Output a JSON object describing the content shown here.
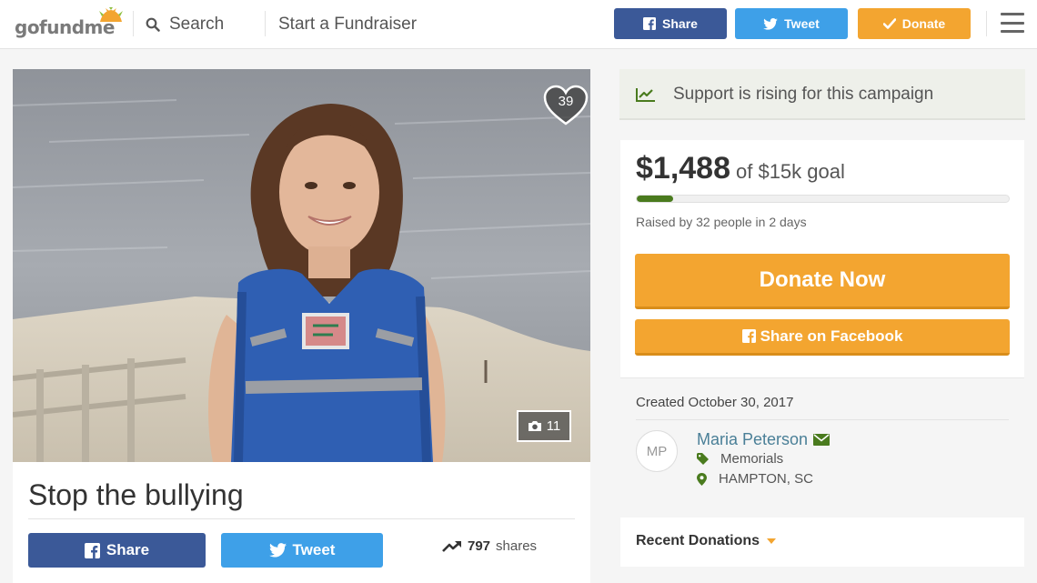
{
  "header": {
    "logo_text": "gofundme",
    "search_label": "Search",
    "start_label": "Start a Fundraiser",
    "share_label": "Share",
    "tweet_label": "Tweet",
    "donate_label": "Donate"
  },
  "photo": {
    "heart_count": "39",
    "photo_count": "11"
  },
  "campaign": {
    "title": "Stop the bullying",
    "share_label": "Share",
    "tweet_label": "Tweet",
    "shares_count": "797",
    "shares_label": "shares"
  },
  "trend": {
    "text": "Support is rising for this campaign"
  },
  "stats": {
    "amount": "$1,488",
    "goal": "of $15k goal",
    "progress_fraction": 0.099,
    "raised_by": "Raised by 32 people in 2 days",
    "donate_now_label": "Donate Now",
    "share_fb_label": "Share on Facebook"
  },
  "organizer": {
    "created": "Created October 30, 2017",
    "initials": "MP",
    "name": "Maria Peterson",
    "category": "Memorials",
    "location": "HAMPTON, SC"
  },
  "recent": {
    "label": "Recent Donations"
  },
  "colors": {
    "facebook": "#3b5998",
    "twitter": "#3ea0e8",
    "donate": "#f3a530",
    "progress": "#4a7b1e",
    "link": "#4a7f97"
  },
  "icons": [
    "search-icon",
    "facebook-icon",
    "twitter-icon",
    "check-icon",
    "menu-icon",
    "heart-icon",
    "camera-icon",
    "trend-icon",
    "envelope-icon",
    "tag-icon",
    "map-pin-icon",
    "caret-down-icon"
  ]
}
